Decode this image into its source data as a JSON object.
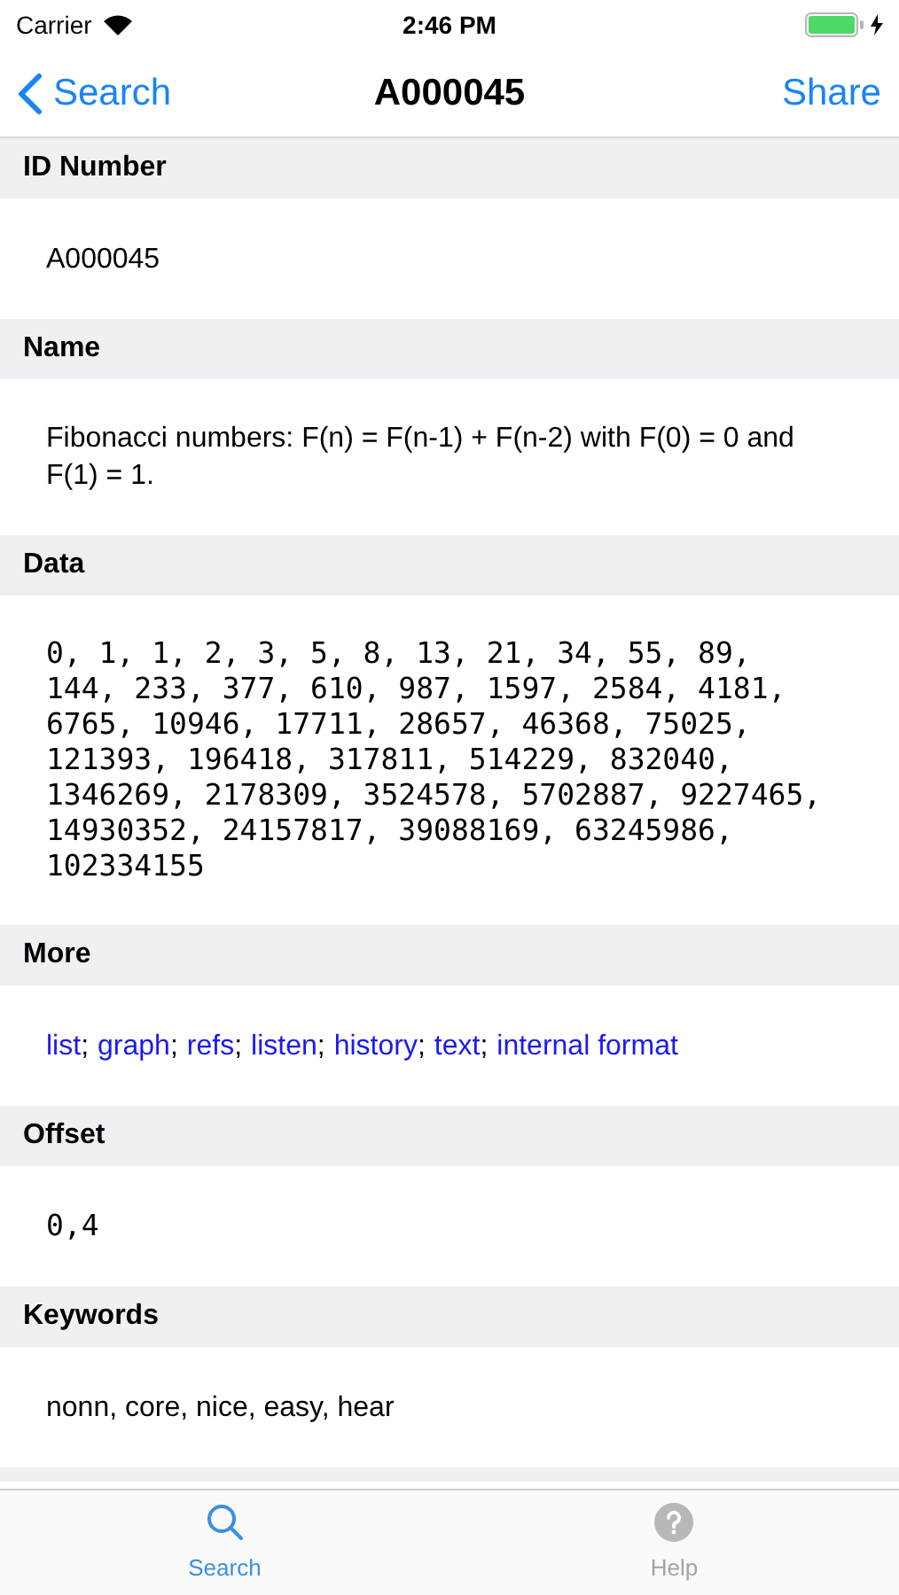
{
  "status_bar": {
    "carrier": "Carrier",
    "time": "2:46 PM"
  },
  "nav": {
    "back": "Search",
    "title": "A000045",
    "action": "Share"
  },
  "sections": [
    {
      "header": "ID Number",
      "kind": "text",
      "text": "A000045"
    },
    {
      "header": "Name",
      "kind": "text",
      "text": "Fibonacci numbers: F(n) = F(n-1) + F(n-2) with F(0) = 0 and F(1) = 1."
    },
    {
      "header": "Data",
      "kind": "mono",
      "lines": [
        "0, 1, 1, 2, 3, 5, 8, 13, 21, 34, 55, 89,",
        "144, 233, 377, 610, 987, 1597, 2584, 4181,",
        "6765, 10946, 17711, 28657, 46368, 75025,",
        "121393, 196418, 317811, 514229, 832040,",
        "1346269, 2178309, 3524578, 5702887, 9227465,",
        "14930352, 24157817, 39088169, 63245986,",
        "102334155"
      ]
    },
    {
      "header": "More",
      "kind": "links",
      "separator": ";",
      "links": [
        "list",
        "graph",
        "refs",
        "listen",
        "history",
        "text",
        "internal format"
      ]
    },
    {
      "header": "Offset",
      "kind": "mono",
      "lines": [
        "0,4"
      ]
    },
    {
      "header": "Keywords",
      "kind": "text",
      "text": "nonn, core, nice, easy, hear"
    }
  ],
  "tabs": [
    {
      "label": "Search",
      "kind": "search",
      "selected": true
    },
    {
      "label": "Help",
      "kind": "help",
      "selected": false
    }
  ]
}
